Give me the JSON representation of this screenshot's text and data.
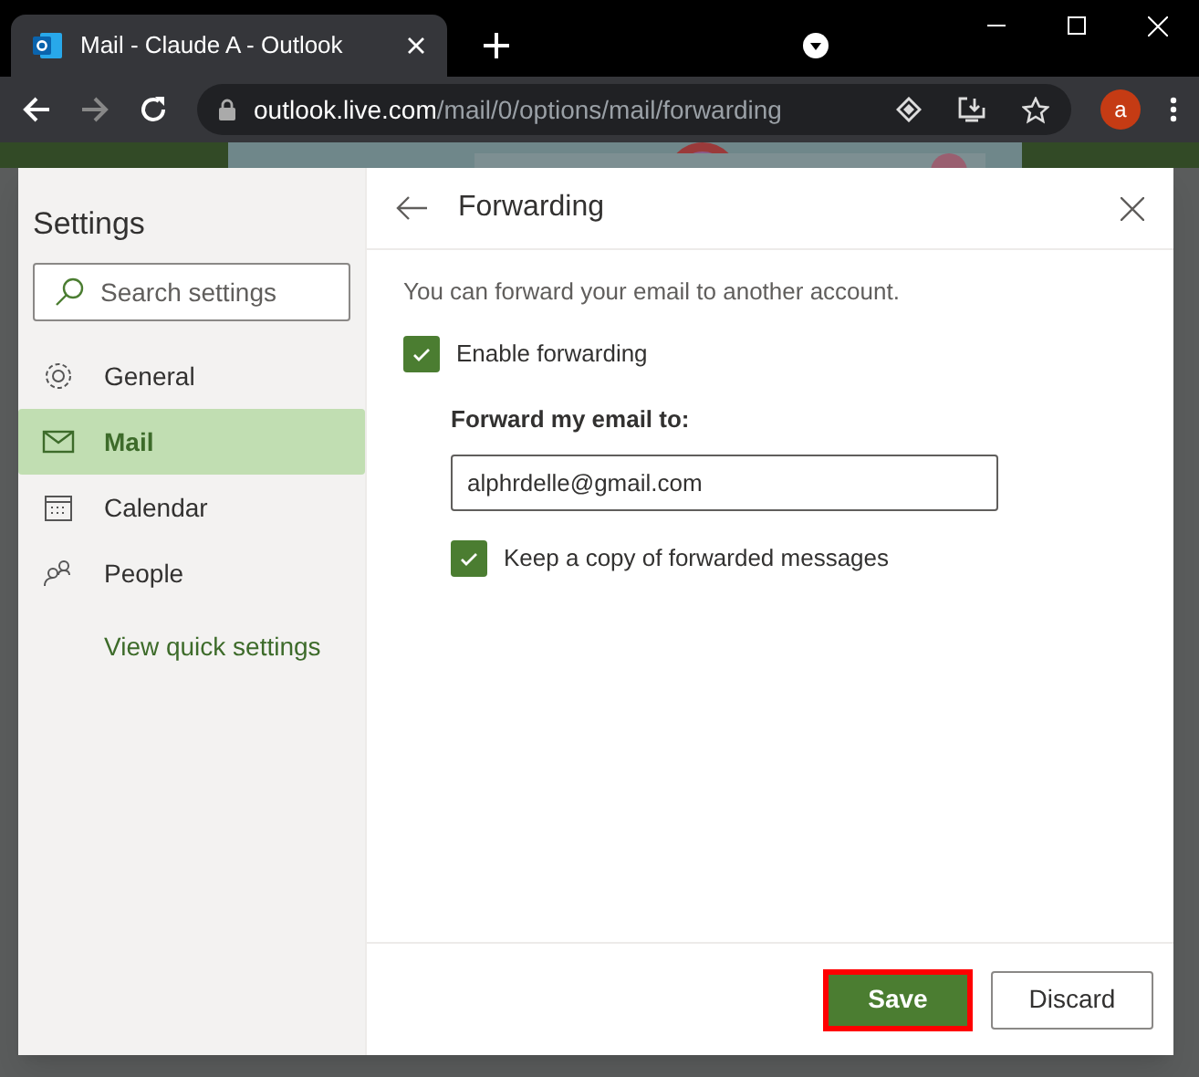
{
  "browser": {
    "tab_title": "Mail - Claude A - Outlook",
    "url_host": "outlook.live.com",
    "url_path": "/mail/0/options/mail/forwarding",
    "avatar": "a"
  },
  "settings": {
    "title": "Settings",
    "search": {
      "placeholder": "Search settings"
    },
    "nav": [
      {
        "label": "General",
        "kind": "gear",
        "selected": false
      },
      {
        "label": "Mail",
        "kind": "mail",
        "selected": true
      },
      {
        "label": "Calendar",
        "kind": "calendar",
        "selected": false
      },
      {
        "label": "People",
        "kind": "people",
        "selected": false
      }
    ],
    "link": "View quick settings"
  },
  "panel": {
    "title": "Forwarding",
    "description": "You can forward your email to another account.",
    "enable": {
      "label": "Enable forwarding",
      "checked": true
    },
    "field_label": "Forward my email to:",
    "field_value": "alphrdelle@gmail.com",
    "keep_copy": {
      "label": "Keep a copy of forwarded messages",
      "checked": true
    },
    "buttons": [
      {
        "label": "Save",
        "kind": "primary"
      },
      {
        "label": "Discard",
        "kind": "secondary"
      }
    ]
  }
}
